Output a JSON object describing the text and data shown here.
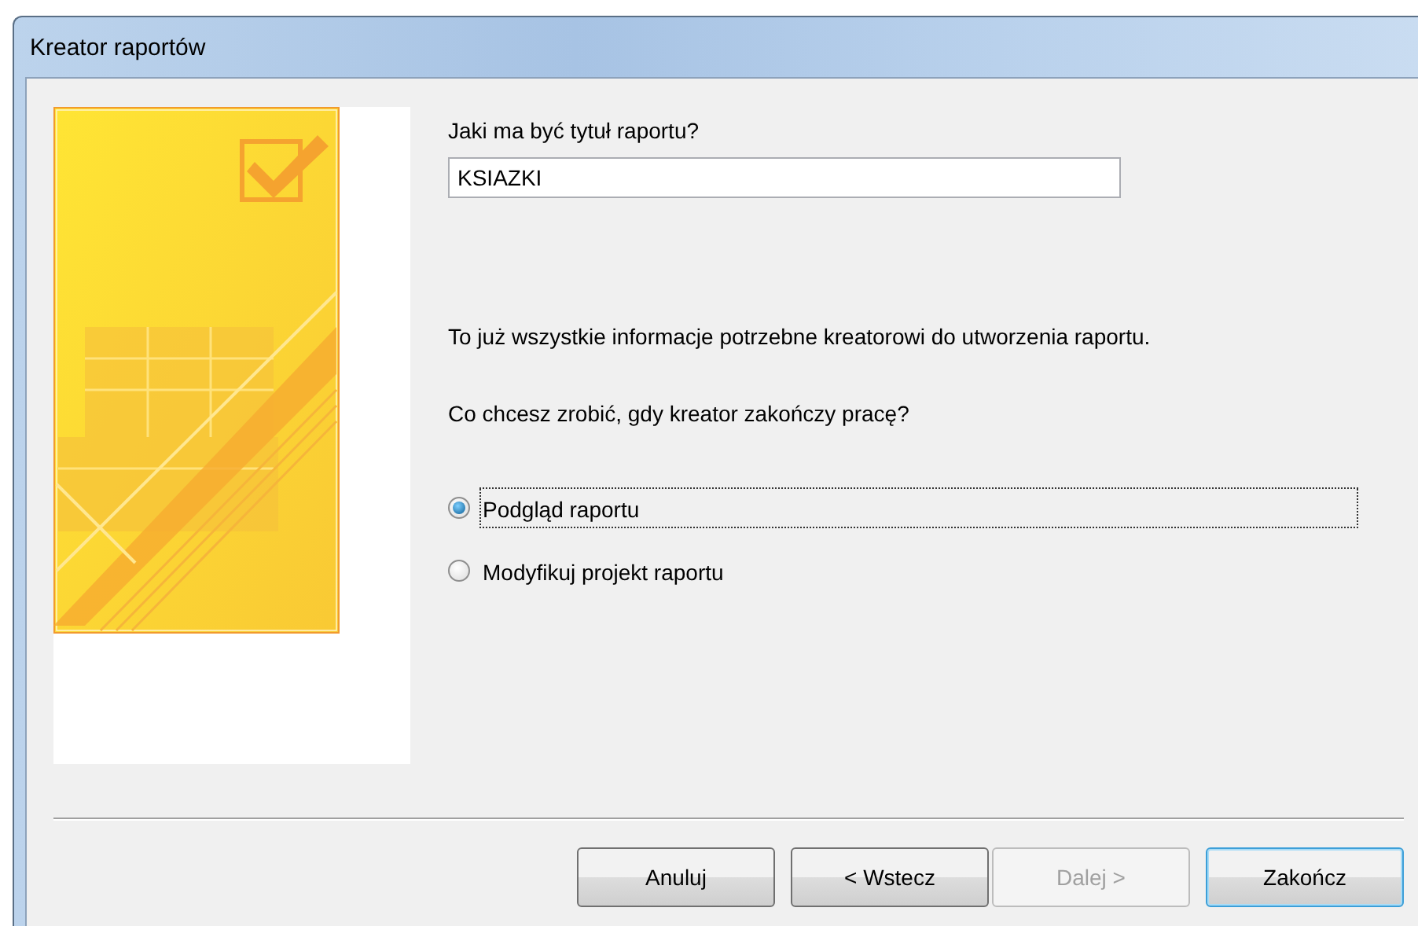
{
  "window": {
    "title": "Kreator raportów"
  },
  "title_prompt": "Jaki ma być tytuł raportu?",
  "title_field": {
    "value": "KSIAZKI"
  },
  "info_text": "To już wszystkie informacje potrzebne kreatorowi do utworzenia raportu.",
  "question": "Co chcesz zrobić, gdy kreator zakończy pracę?",
  "options": [
    {
      "label": "Podgląd raportu",
      "selected": true,
      "focused": true
    },
    {
      "label": "Modyfikuj projekt raportu",
      "selected": false,
      "focused": false
    }
  ],
  "buttons": [
    {
      "label": "Anuluj",
      "disabled": false,
      "default": false
    },
    {
      "label": "< Wstecz",
      "disabled": false,
      "default": false
    },
    {
      "label": "Dalej >",
      "disabled": true,
      "default": false
    },
    {
      "label": "Zakończ",
      "disabled": false,
      "default": true
    }
  ]
}
